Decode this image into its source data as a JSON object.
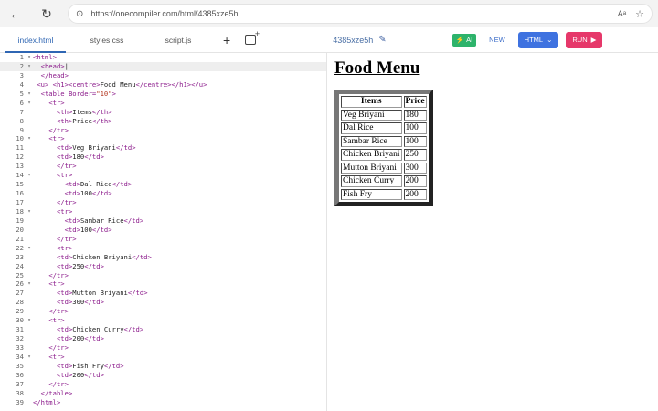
{
  "browser": {
    "url": "https://onecompiler.com/html/4385xze5h",
    "read_aloud": "Aᵃ"
  },
  "editor": {
    "tabs": [
      "index.html",
      "styles.css",
      "script.js"
    ],
    "active_tab": "index.html",
    "project_id": "4385xze5h",
    "ai_label": "AI",
    "new_label": "NEW",
    "language_label": "HTML",
    "run_label": "RUN",
    "accent_color": "#2f66b3",
    "run_color": "#e6386a"
  },
  "code_lines": [
    {
      "n": "1",
      "fold": "▾",
      "text": "<html>"
    },
    {
      "n": "2",
      "fold": "▾",
      "text": "  <head>|"
    },
    {
      "n": "3",
      "fold": "",
      "text": "  </head>"
    },
    {
      "n": "4",
      "fold": "",
      "text": " <u> <h1><centre>Food Menu</centre></h1></u>"
    },
    {
      "n": "5",
      "fold": "▾",
      "text": "  <table Border=\"10\">"
    },
    {
      "n": "6",
      "fold": "▾",
      "text": "    <tr>"
    },
    {
      "n": "7",
      "fold": "",
      "text": "      <th>Items</th>"
    },
    {
      "n": "8",
      "fold": "",
      "text": "      <th>Price</th>"
    },
    {
      "n": "9",
      "fold": "",
      "text": "    </tr>"
    },
    {
      "n": "10",
      "fold": "▾",
      "text": "    <tr>"
    },
    {
      "n": "11",
      "fold": "",
      "text": "      <td>Veg Briyani</td>"
    },
    {
      "n": "12",
      "fold": "",
      "text": "      <td>180</td>"
    },
    {
      "n": "13",
      "fold": "",
      "text": "      </tr>"
    },
    {
      "n": "14",
      "fold": "▾",
      "text": "      <tr>"
    },
    {
      "n": "15",
      "fold": "",
      "text": "        <td>Dal Rice</td>"
    },
    {
      "n": "16",
      "fold": "",
      "text": "        <td>100</td>"
    },
    {
      "n": "17",
      "fold": "",
      "text": "      </tr>"
    },
    {
      "n": "18",
      "fold": "▾",
      "text": "      <tr>"
    },
    {
      "n": "19",
      "fold": "",
      "text": "        <td>Sambar Rice</td>"
    },
    {
      "n": "20",
      "fold": "",
      "text": "        <td>100</td>"
    },
    {
      "n": "21",
      "fold": "",
      "text": "      </tr>"
    },
    {
      "n": "22",
      "fold": "▾",
      "text": "      <tr>"
    },
    {
      "n": "23",
      "fold": "",
      "text": "      <td>Chicken Briyani</td>"
    },
    {
      "n": "24",
      "fold": "",
      "text": "      <td>250</td>"
    },
    {
      "n": "25",
      "fold": "",
      "text": "    </tr>"
    },
    {
      "n": "26",
      "fold": "▾",
      "text": "    <tr>"
    },
    {
      "n": "27",
      "fold": "",
      "text": "      <td>Mutton Briyani</td>"
    },
    {
      "n": "28",
      "fold": "",
      "text": "      <td>300</td>"
    },
    {
      "n": "29",
      "fold": "",
      "text": "    </tr>"
    },
    {
      "n": "30",
      "fold": "▾",
      "text": "    <tr>"
    },
    {
      "n": "31",
      "fold": "",
      "text": "      <td>Chicken Curry</td>"
    },
    {
      "n": "32",
      "fold": "",
      "text": "      <td>200</td>"
    },
    {
      "n": "33",
      "fold": "",
      "text": "    </tr>"
    },
    {
      "n": "34",
      "fold": "▾",
      "text": "    <tr>"
    },
    {
      "n": "35",
      "fold": "",
      "text": "      <td>Fish Fry</td>"
    },
    {
      "n": "36",
      "fold": "",
      "text": "      <td>200</td>"
    },
    {
      "n": "37",
      "fold": "",
      "text": "    </tr>"
    },
    {
      "n": "38",
      "fold": "",
      "text": "  </table>"
    },
    {
      "n": "39",
      "fold": "",
      "text": "</html>"
    }
  ],
  "preview": {
    "heading": "Food Menu",
    "columns": [
      "Items",
      "Price"
    ],
    "rows": [
      [
        "Veg Briyani",
        "180"
      ],
      [
        "Dal Rice",
        "100"
      ],
      [
        "Sambar Rice",
        "100"
      ],
      [
        "Chicken Briyani",
        "250"
      ],
      [
        "Mutton Briyani",
        "300"
      ],
      [
        "Chicken Curry",
        "200"
      ],
      [
        "Fish Fry",
        "200"
      ]
    ]
  }
}
